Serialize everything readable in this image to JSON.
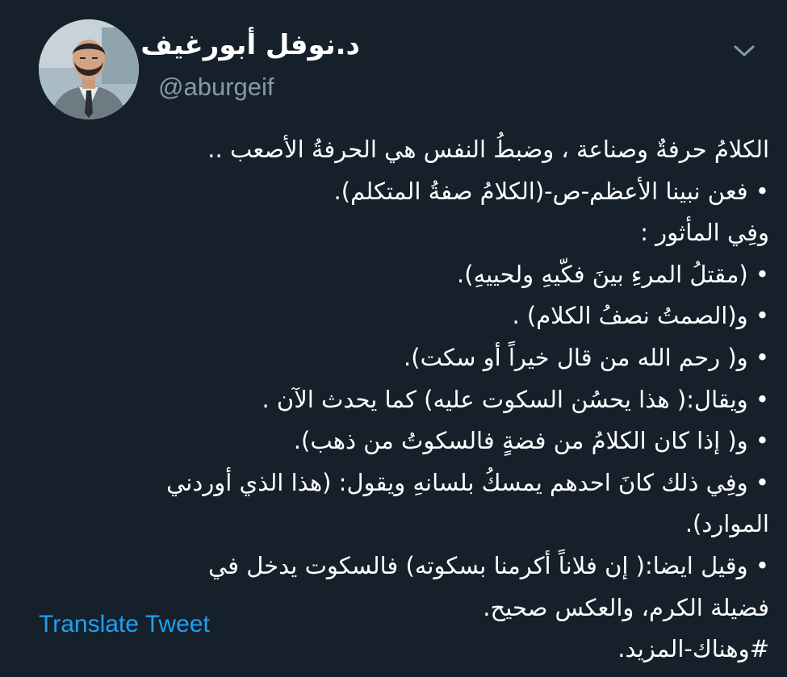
{
  "author": {
    "name": "د.نوفل أبورغيف",
    "handle": "@aburgeif"
  },
  "tweet": {
    "lines": [
      "الكلامُ حرفةٌ وصناعة ، وضبطُ النفس هي الحرفةُ الأصعب ..",
      "• فعن نبينا الأعظم-ص-(الكلامُ صفةُ المتكلم).",
      "وفِي المأثور :",
      "• (مقتلُ المرءِ بينَ فكّيهِ ولحييهِ).",
      "• و(الصمتُ نصفُ الكلام) .",
      "• و( رحم الله من قال خيراً أو سكت).",
      "• ويقال:( هذا يحسُن السكوت عليه) كما يحدث الآن .",
      "• و( إذا كان الكلامُ من فضةٍ فالسكوتُ من ذهب).",
      "• وفِي ذلك كانَ احدهم يمسكُ بلسانهِ ويقول: (هذا الذي أوردني",
      "الموارد).",
      "• وقيل ايضا:( إن فلاناً أكرمنا بسكوته) فالسكوت يدخل في",
      "فضيلة الكرم، والعكس صحيح.",
      "#وهناك-المزيد."
    ]
  },
  "actions": {
    "translate_label": "Translate Tweet"
  },
  "icons": {
    "menu": "chevron-down-icon",
    "avatar": "avatar"
  },
  "colors": {
    "background": "#15202b",
    "text": "#ffffff",
    "secondary": "#8899a6",
    "link": "#1da1f2"
  }
}
